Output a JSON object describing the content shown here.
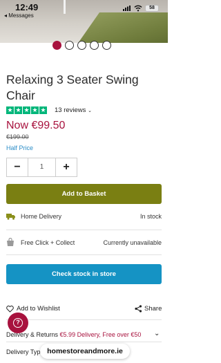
{
  "status_bar": {
    "time": "12:49",
    "back_label": "◂ Messages",
    "battery": "58"
  },
  "carousel": {
    "page_count": 5,
    "active_index": 0
  },
  "product": {
    "title": "Relaxing 3 Seater Swing Chair",
    "rating_stars": 5,
    "reviews_label": "13 reviews",
    "price_now": "Now €99.50",
    "price_was": "€199.00",
    "price_note": "Half Price"
  },
  "quantity": {
    "minus": "−",
    "value": "1",
    "plus": "+"
  },
  "actions": {
    "add_to_basket": "Add to Basket",
    "check_stock": "Check stock in store",
    "wishlist": "Add to Wishlist",
    "share": "Share"
  },
  "fulfilment": {
    "home_delivery": {
      "label": "Home Delivery",
      "status": "In stock"
    },
    "click_collect": {
      "label": "Free Click + Collect",
      "status": "Currently unavailable"
    }
  },
  "delivery": {
    "heading": "Delivery & Returns",
    "promo": "€5.99 Delivery, Free over €50",
    "type_label": "Delivery Typ"
  },
  "browser": {
    "url": "homestoreandmore.ie"
  },
  "colors": {
    "brand": "#a8123e",
    "basket_green": "#7a7f12",
    "store_blue": "#1593c4",
    "trustpilot": "#00b67a"
  }
}
